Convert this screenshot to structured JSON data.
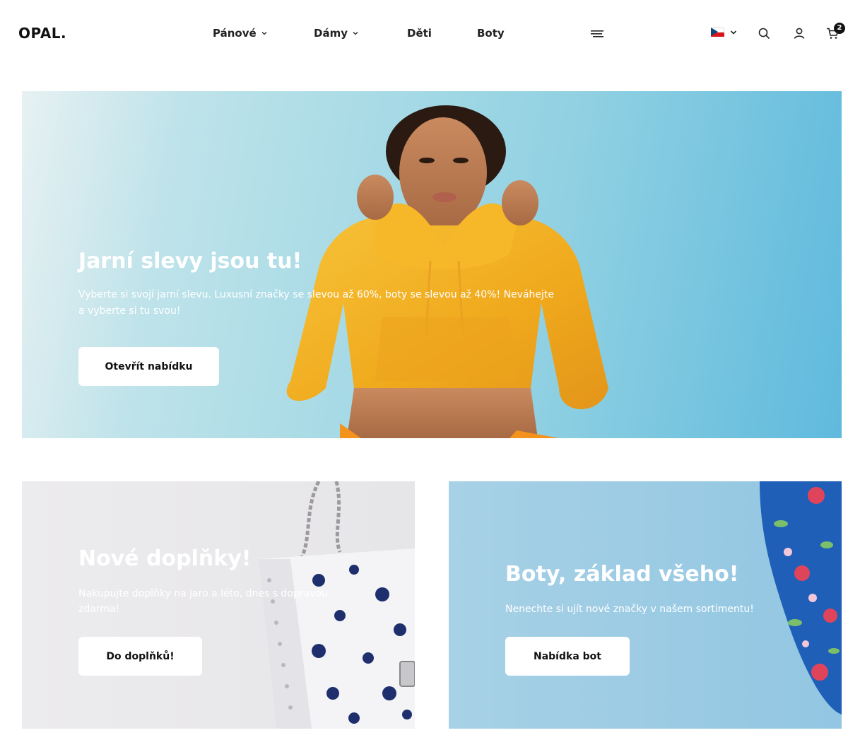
{
  "brand": {
    "logo": "OPAL."
  },
  "nav": {
    "items": [
      {
        "label": "Pánové",
        "has_dropdown": true
      },
      {
        "label": "Dámy",
        "has_dropdown": true
      },
      {
        "label": "Děti",
        "has_dropdown": false
      },
      {
        "label": "Boty",
        "has_dropdown": false
      }
    ],
    "menu_icon": "hamburger-icon"
  },
  "header_actions": {
    "language_flag": "cz-flag-icon",
    "search_icon": "search-icon",
    "account_icon": "user-icon",
    "cart_icon": "cart-icon",
    "cart_count": "2"
  },
  "hero": {
    "title": "Jarní slevy jsou tu!",
    "text": "Vyberte si svojí jarní slevu. Luxusní značky se slevou až 60%, boty se slevou až 40%! Neváhejte a vyberte si tu svou!",
    "button_label": "Otevřít nabídku"
  },
  "promos": [
    {
      "title": "Nové doplňky!",
      "text": "Nakupujte doplňky na jaro a léto, dnes s dopravou zdarma!",
      "button_label": "Do doplňků!"
    },
    {
      "title": "Boty, základ všeho!",
      "text": "Nenechte si ujít nové značky v našem sortimentu!",
      "button_label": "Nabídka bot"
    }
  ],
  "colors": {
    "accent_text": "#ffffff",
    "hero_sky": "#8fd0e2",
    "hoodie": "#f2b52c",
    "card_grey": "#e8e7ea",
    "card_blue": "#9acbe4"
  }
}
